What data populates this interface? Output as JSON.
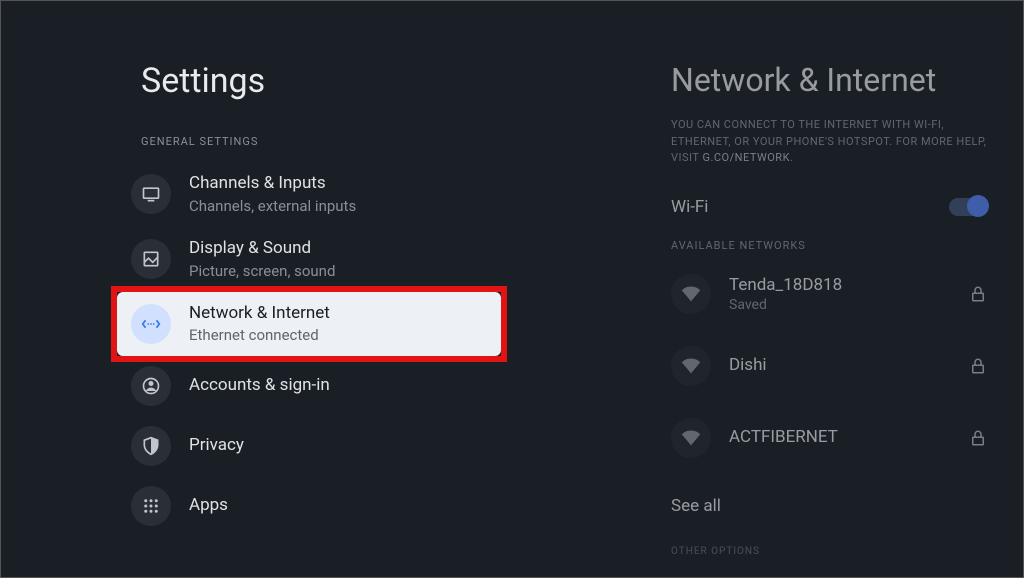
{
  "left": {
    "title": "Settings",
    "general_header": "GENERAL SETTINGS",
    "items": [
      {
        "title": "Channels & Inputs",
        "sub": "Channels, external inputs"
      },
      {
        "title": "Display & Sound",
        "sub": "Picture, screen, sound"
      },
      {
        "title": "Network & Internet",
        "sub": "Ethernet connected"
      },
      {
        "title": "Accounts & sign-in",
        "sub": ""
      },
      {
        "title": "Privacy",
        "sub": ""
      },
      {
        "title": "Apps",
        "sub": ""
      }
    ]
  },
  "right": {
    "title": "Network & Internet",
    "desc_a": "YOU CAN CONNECT TO THE INTERNET WITH WI-FI, ETHERNET, OR YOUR PHONE'S HOTSPOT. FOR MORE HELP, VISIT ",
    "desc_link": "G.CO/NETWORK",
    "desc_b": ".",
    "wifi_label": "Wi-Fi",
    "avail_header": "AVAILABLE NETWORKS",
    "networks": [
      {
        "name": "Tenda_18D818",
        "sub": "Saved",
        "locked": true
      },
      {
        "name": "Dishi",
        "sub": "",
        "locked": true
      },
      {
        "name": "ACTFIBERNET",
        "sub": "",
        "locked": true
      }
    ],
    "see_all": "See all",
    "other_header": "OTHER OPTIONS"
  }
}
